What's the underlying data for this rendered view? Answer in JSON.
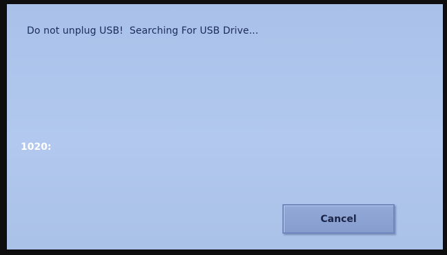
{
  "dialog": {
    "message": "Do not unplug USB!  Searching For USB Drive...",
    "code": "1020:",
    "cancel_label": "Cancel"
  }
}
